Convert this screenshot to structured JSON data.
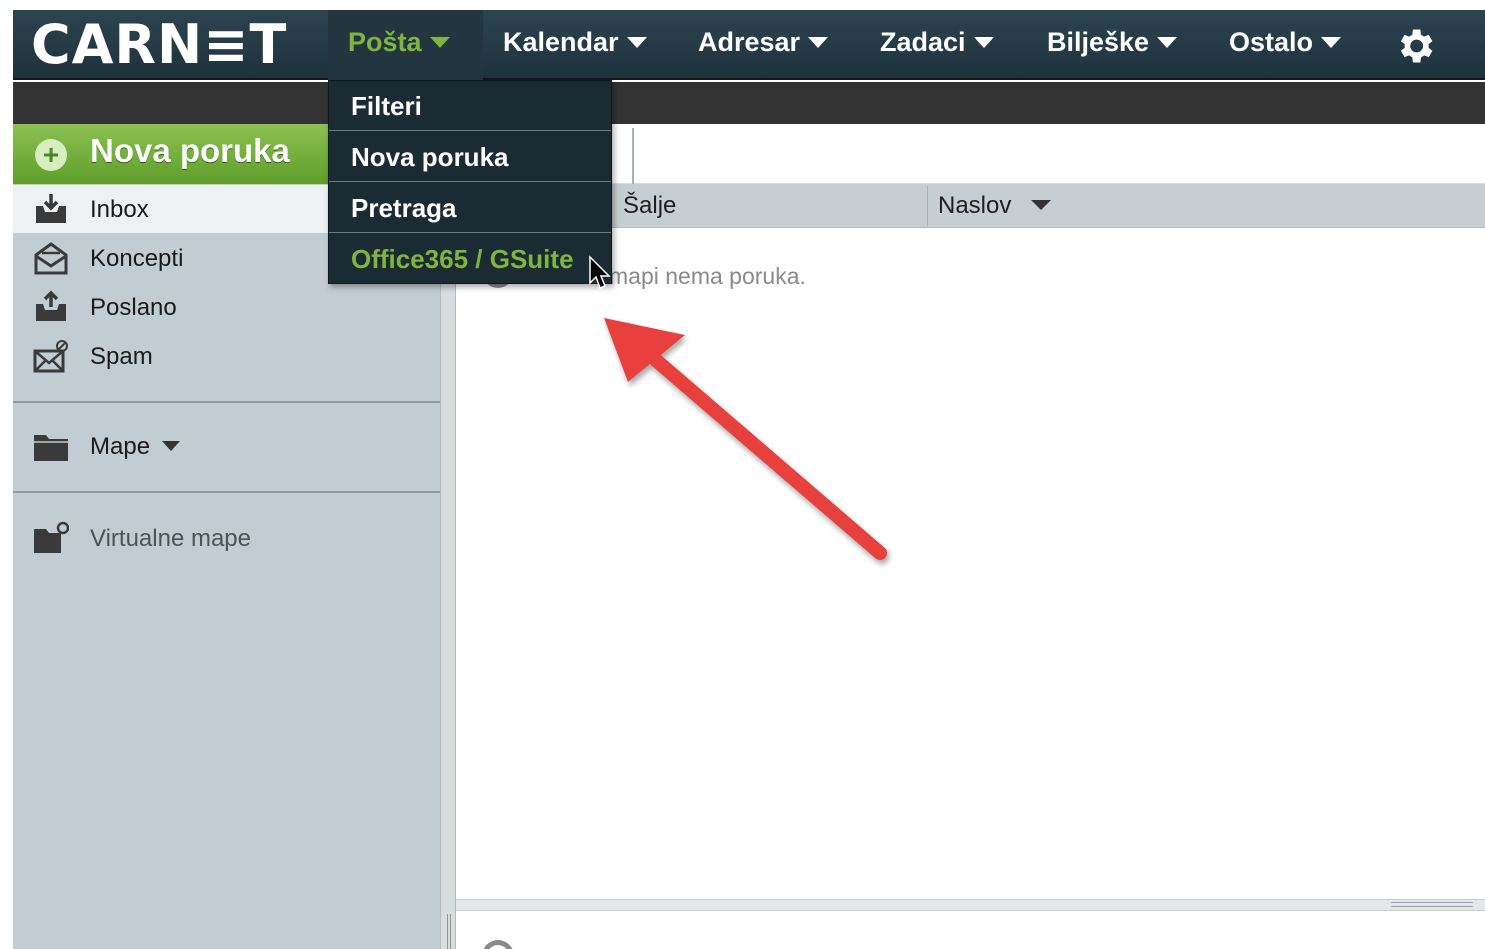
{
  "app": {
    "logo": "CARN≡T"
  },
  "nav": {
    "items": [
      {
        "label": "Pošta",
        "active": true
      },
      {
        "label": "Kalendar"
      },
      {
        "label": "Adresar"
      },
      {
        "label": "Zadaci"
      },
      {
        "label": "Bilješke"
      },
      {
        "label": "Ostalo"
      }
    ],
    "settings_icon": "gear-icon"
  },
  "dropdown": {
    "items": [
      {
        "label": "Filteri"
      },
      {
        "label": "Nova poruka"
      },
      {
        "label": "Pretraga"
      },
      {
        "label": "Office365 / GSuite",
        "hovered": true
      }
    ]
  },
  "sidebar": {
    "new_message": "Nova poruka",
    "folders": [
      {
        "label": "Inbox",
        "icon": "inbox-icon",
        "selected": true
      },
      {
        "label": "Koncepti",
        "icon": "drafts-icon"
      },
      {
        "label": "Poslano",
        "icon": "sent-icon"
      },
      {
        "label": "Spam",
        "icon": "spam-icon"
      }
    ],
    "mape": "Mape",
    "virtual_folders": "Virtualne mape"
  },
  "messages": {
    "columns": {
      "sender": "Šalje",
      "subject": "Naslov"
    },
    "empty_text": "U mapi nema poruka."
  },
  "colors": {
    "accent_green": "#7fb53f",
    "topbar": "#23353f",
    "sidebar_bg": "#c2cdd3",
    "annotation_red": "#e8413c"
  }
}
